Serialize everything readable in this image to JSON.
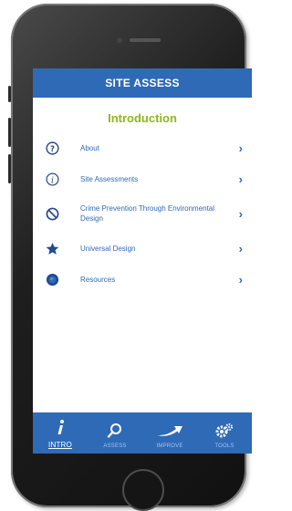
{
  "header": {
    "title": "SITE ASSESS"
  },
  "section": {
    "title": "Introduction"
  },
  "menu": {
    "items": [
      {
        "label": "About",
        "icon": "question-circle-icon"
      },
      {
        "label": "Site Assessments",
        "icon": "info-circle-icon"
      },
      {
        "label": "Crime Prevention Through Environmental Design",
        "icon": "prohibited-icon"
      },
      {
        "label": "Universal Design",
        "icon": "star-icon"
      },
      {
        "label": "Resources",
        "icon": "globe-icon"
      }
    ],
    "chevron": "›"
  },
  "tabbar": {
    "tabs": [
      {
        "label": "INTRO",
        "icon": "info-italic-icon",
        "active": true
      },
      {
        "label": "ASSESS",
        "icon": "search-icon",
        "active": false
      },
      {
        "label": "IMPROVE",
        "icon": "arrow-swoosh-icon",
        "active": false
      },
      {
        "label": "TOOLS",
        "icon": "gears-icon",
        "active": false
      }
    ]
  },
  "colors": {
    "primary": "#2f6ab7",
    "accent": "#8cb81f",
    "tab_inactive_text": "#a9c4ea",
    "phone_body": "#1e1e1e"
  }
}
